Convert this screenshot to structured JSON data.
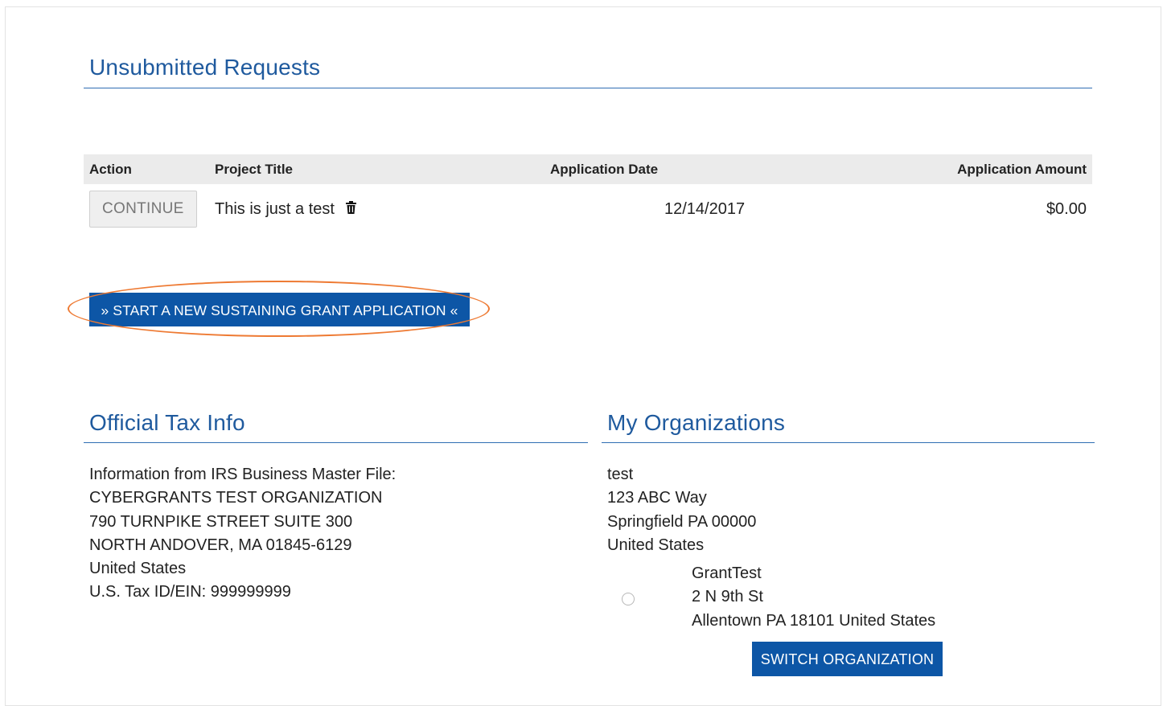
{
  "unsubmitted": {
    "title": "Unsubmitted Requests",
    "columns": {
      "action": "Action",
      "project_title": "Project Title",
      "application_date": "Application Date",
      "application_amount": "Application Amount"
    },
    "rows": [
      {
        "action_label": "CONTINUE",
        "project_title": "This is just a test",
        "trash_icon": "trash-icon",
        "application_date": "12/14/2017",
        "application_amount": "$0.00"
      }
    ]
  },
  "start_button_label": "» START A NEW SUSTAINING GRANT APPLICATION «",
  "tax_info": {
    "title": "Official Tax Info",
    "lines": [
      "Information from IRS Business Master File:",
      "CYBERGRANTS TEST ORGANIZATION",
      "790 TURNPIKE STREET SUITE 300",
      "NORTH ANDOVER, MA 01845-6129",
      "United States",
      "U.S. Tax ID/EIN: 999999999"
    ]
  },
  "organizations": {
    "title": "My Organizations",
    "current": [
      "test",
      "123 ABC Way",
      "Springfield PA 00000",
      "United States"
    ],
    "alternate": [
      "GrantTest",
      "2 N 9th St",
      "Allentown PA 18101 United States"
    ],
    "switch_label": "SWITCH ORGANIZATION"
  },
  "colors": {
    "accent": "#0d56a6",
    "heading": "#1f5a9e",
    "highlight": "#ee7a33"
  }
}
